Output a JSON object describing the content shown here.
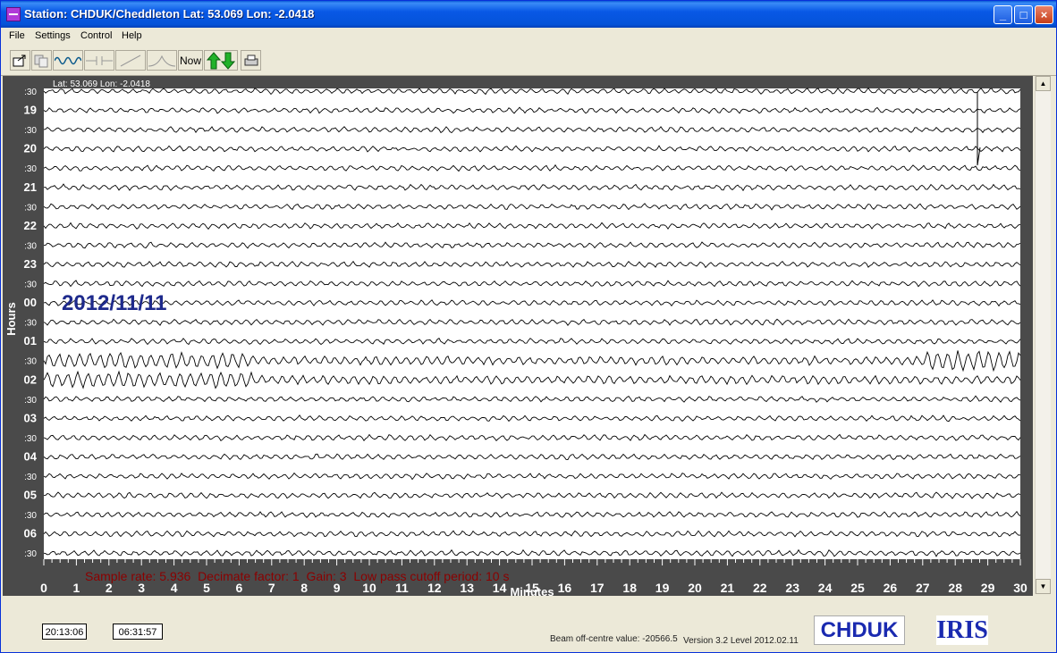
{
  "window": {
    "title": "Station: CHDUK/Cheddleton Lat: 53.069 Lon: -2.0418",
    "minimize": "_",
    "maximize": "□",
    "close": "×"
  },
  "menu": [
    "File",
    "Settings",
    "Control",
    "Help"
  ],
  "toolbar": {
    "now_label": "Now",
    "icons": [
      "open-icon",
      "copy-icon",
      "waveform-icon",
      "filter-icon",
      "slope-icon",
      "peak-icon",
      "now-button",
      "up-down-arrows-icon",
      "print-icon"
    ]
  },
  "plot": {
    "latlon_label": "Lat: 53.069 Lon: -2.0418",
    "date_label": "2012/11/11",
    "y_axis_title": "Hours",
    "row_labels": [
      ":30",
      "19",
      ":30",
      "20",
      ":30",
      "21",
      ":30",
      "22",
      ":30",
      "23",
      ":30",
      "00",
      ":30",
      "01",
      ":30",
      "02",
      ":30",
      "03",
      ":30",
      "04",
      ":30",
      "05",
      ":30",
      "06",
      ":30"
    ],
    "status_line": "Sample rate: 5.936  Decimate factor: 1  Gain: 3  Low pass cutoff period: 10 s",
    "x_axis_title": "Minutes",
    "x_ticks": [
      "0",
      "1",
      "2",
      "3",
      "4",
      "5",
      "6",
      "7",
      "8",
      "9",
      "10",
      "11",
      "12",
      "13",
      "14",
      "15",
      "16",
      "17",
      "18",
      "19",
      "20",
      "21",
      "22",
      "23",
      "24",
      "25",
      "26",
      "27",
      "28",
      "29",
      "30"
    ],
    "trace_color": "#000000",
    "background_color": "#4a4a4a",
    "date_color": "#1e2a8c",
    "status_color": "#8b0000"
  },
  "footer": {
    "time_start": "20:13:06",
    "time_end": "06:31:57",
    "beam_label": "Beam off-centre value: -20566.5",
    "version_label": "Version 3.2 Level 2012.02.11",
    "station_logo": "CHDUK",
    "iris_logo": "IRIS"
  }
}
